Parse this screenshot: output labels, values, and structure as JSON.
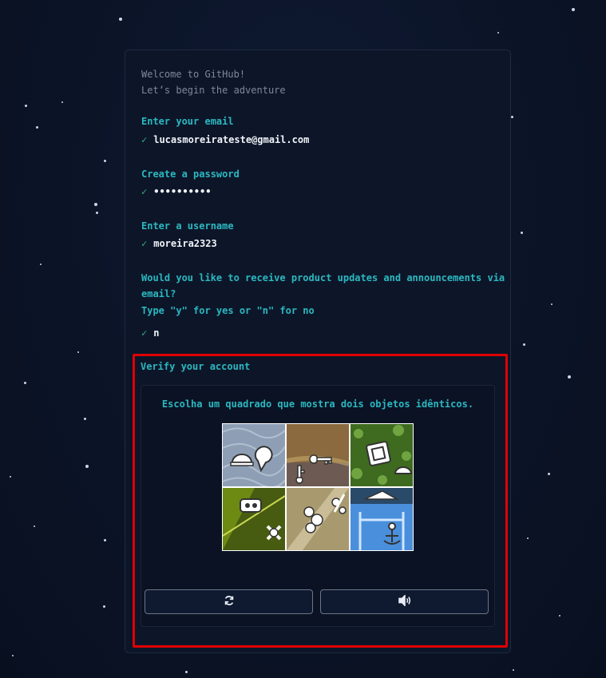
{
  "intro": {
    "line1": "Welcome to GitHub!",
    "line2": "Let’s begin the adventure"
  },
  "email": {
    "prompt": "Enter your email",
    "value": "lucasmoreirateste@gmail.com"
  },
  "password": {
    "prompt": "Create a password",
    "value": "••••••••••"
  },
  "username": {
    "prompt": "Enter a username",
    "value": "moreira2323"
  },
  "updates": {
    "prompt_line1": "Would you like to receive product updates and announcements via",
    "prompt_line2": "email?",
    "prompt_line3": "Type \"y\" for yes or \"n\" for no",
    "value": "n"
  },
  "check_mark": "✓",
  "verify": {
    "heading": "Verify your account",
    "captcha_instruction": "Escolha um quadrado que mostra dois objetos idênticos.",
    "tiles": [
      {
        "name": "tile-1",
        "bg": "#8e9fb5"
      },
      {
        "name": "tile-2",
        "bg": "#8a6a3e"
      },
      {
        "name": "tile-3",
        "bg": "#3e6b1f"
      },
      {
        "name": "tile-4",
        "bg": "#6d8a12"
      },
      {
        "name": "tile-5",
        "bg": "#a89a6e"
      },
      {
        "name": "tile-6",
        "bg": "#4a8fdc"
      }
    ],
    "reload_icon": "reload-icon",
    "audio_icon": "speaker-icon"
  },
  "colors": {
    "accent": "#2bb8c0",
    "check": "#34b07c",
    "highlight_border": "#e00000"
  }
}
